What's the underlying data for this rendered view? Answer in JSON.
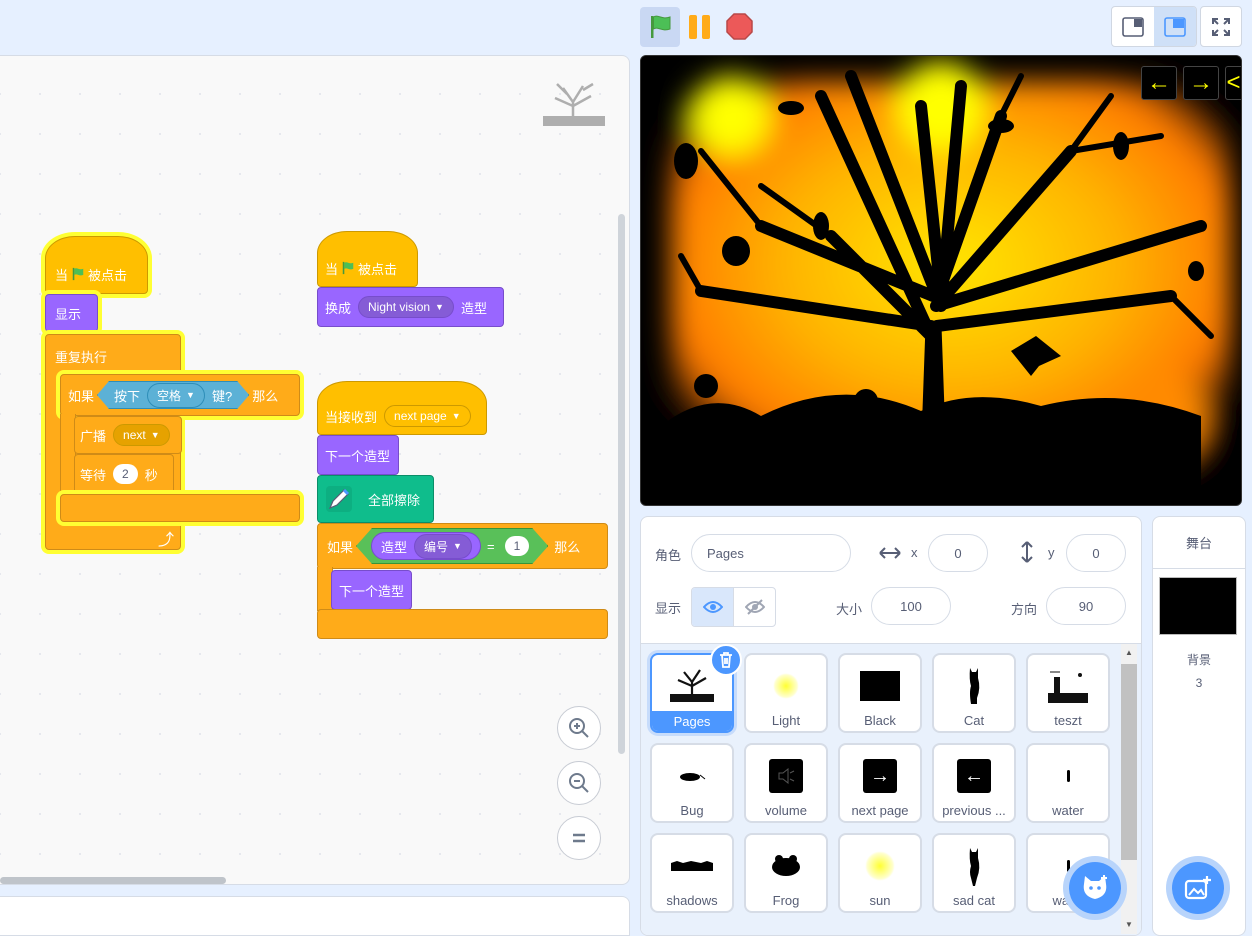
{
  "toolbar": {
    "green_flag": "green-flag",
    "pause": "pause",
    "stop": "stop"
  },
  "scripts": {
    "script1": {
      "hat_when": "当",
      "hat_clicked": "被点击",
      "show": "显示",
      "forever": "重复执行",
      "if": "如果",
      "key_pressed": "按下",
      "key": "空格",
      "key_suffix": "键?",
      "then": "那么",
      "broadcast": "广播",
      "broadcast_msg": "next",
      "wait": "等待",
      "wait_value": "2",
      "wait_unit": "秒"
    },
    "script2": {
      "hat_when": "当",
      "hat_clicked": "被点击",
      "switch_costume": "换成",
      "costume": "Night vision",
      "costume_suffix": "造型"
    },
    "script3": {
      "when_receive": "当接收到",
      "message": "next page",
      "next_costume": "下一个造型",
      "erase_all": "全部擦除",
      "if": "如果",
      "costume": "造型",
      "costume_prop": "编号",
      "equals": "=",
      "equals_value": "1",
      "then": "那么",
      "next_costume2": "下一个造型"
    }
  },
  "sprite_info": {
    "sprite_label": "角色",
    "sprite_name": "Pages",
    "x_label": "x",
    "x_value": "0",
    "y_label": "y",
    "y_value": "0",
    "show_label": "显示",
    "size_label": "大小",
    "size_value": "100",
    "direction_label": "方向",
    "direction_value": "90"
  },
  "sprites": [
    {
      "name": "Pages"
    },
    {
      "name": "Light"
    },
    {
      "name": "Black"
    },
    {
      "name": "Cat"
    },
    {
      "name": "teszt"
    },
    {
      "name": "Bug"
    },
    {
      "name": "volume"
    },
    {
      "name": "next page"
    },
    {
      "name": "previous ..."
    },
    {
      "name": "water"
    },
    {
      "name": "shadows"
    },
    {
      "name": "Frog"
    },
    {
      "name": "sun"
    },
    {
      "name": "sad cat"
    },
    {
      "name": "wat..."
    }
  ],
  "stage_panel": {
    "title": "舞台",
    "backdrops_label": "背景",
    "backdrops_count": "3"
  },
  "stage_arrows": [
    "←",
    "→",
    "<"
  ],
  "colors": {
    "events": "#ffbf00",
    "control": "#ffab19",
    "looks": "#9966ff",
    "sensing": "#5cb1d6",
    "operators": "#59c059",
    "pen": "#0fbd8c",
    "accent": "#4c97ff"
  }
}
